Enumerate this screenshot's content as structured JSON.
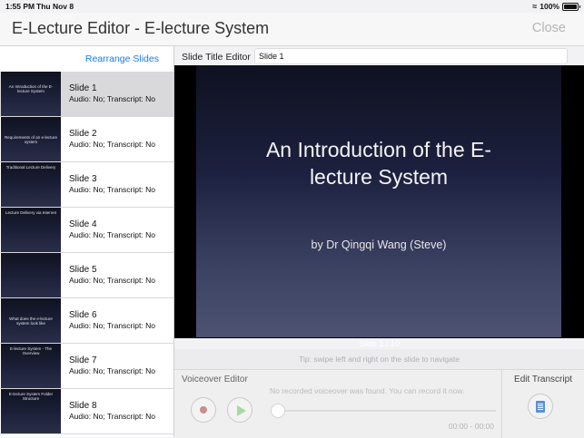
{
  "status_bar": {
    "time": "1:55 PM",
    "date": "Thu Nov 8",
    "battery": "100%"
  },
  "nav": {
    "title": "E-Lecture Editor - E-lecture System",
    "close_label": "Close"
  },
  "sidebar": {
    "rearrange_label": "Rearrange Slides",
    "slides": [
      {
        "title": "Slide 1",
        "status": "Audio: No; Transcript: No",
        "thumb_text": "An Introduction of the E-lecture System"
      },
      {
        "title": "Slide 2",
        "status": "Audio: No; Transcript: No",
        "thumb_text": "Requirements of an e-lecture system"
      },
      {
        "title": "Slide 3",
        "status": "Audio: No; Transcript: No",
        "thumb_text": "Traditional Lecture Delivery"
      },
      {
        "title": "Slide 4",
        "status": "Audio: No; Transcript: No",
        "thumb_text": "Lecture Delivery via Internet"
      },
      {
        "title": "Slide 5",
        "status": "Audio: No; Transcript: No",
        "thumb_text": ""
      },
      {
        "title": "Slide 6",
        "status": "Audio: No; Transcript: No",
        "thumb_text": "What does the e-lecture system look like"
      },
      {
        "title": "Slide 7",
        "status": "Audio: No; Transcript: No",
        "thumb_text": "E-lecture System - The Overview"
      },
      {
        "title": "Slide 8",
        "status": "Audio: No; Transcript: No",
        "thumb_text": "E-lecture System Folder Structure"
      }
    ]
  },
  "editor": {
    "title_label": "Slide Title Editor",
    "title_value": "Slide 1",
    "slide_heading": "An Introduction of the E-lecture System",
    "slide_subtitle": "by Dr Qingqi Wang (Steve)",
    "counter": "Slide 1 / 10",
    "tip": "Tip: swipe left and right on the slide to navigate"
  },
  "voiceover": {
    "label": "Voiceover Editor",
    "message": "No recorded voiceover was found. You can record it now.",
    "time": "00:00 - 00:00"
  },
  "transcript": {
    "label": "Edit Transcript"
  }
}
